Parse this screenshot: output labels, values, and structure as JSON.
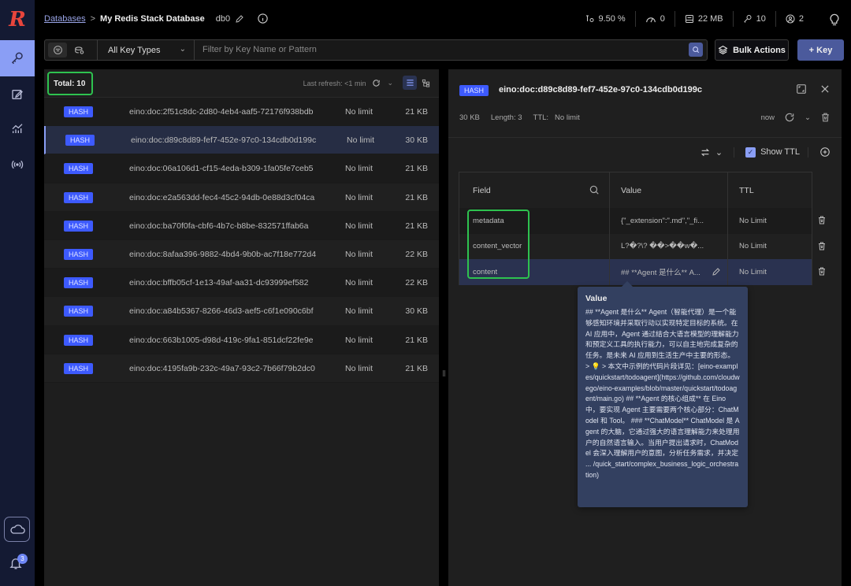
{
  "app": {
    "logo": "R"
  },
  "sidebar": {
    "items": [
      {
        "name": "browser",
        "icon": "key-icon",
        "active": true
      },
      {
        "name": "workbench",
        "icon": "edit-icon",
        "active": false
      },
      {
        "name": "analytics",
        "icon": "chart-icon",
        "active": false
      },
      {
        "name": "pubsub",
        "icon": "broadcast-icon",
        "active": false
      }
    ],
    "cloud_icon": "cloud-icon",
    "notifications_count": "3"
  },
  "header": {
    "breadcrumb_link": "Databases",
    "breadcrumb_sep": ">",
    "database_name": "My Redis Stack Database",
    "db_index": "db0",
    "stats": {
      "cpu": "9.50 %",
      "ops": "0",
      "memory": "22 MB",
      "keys": "10",
      "clients": "2"
    }
  },
  "toolbar": {
    "key_type_selected": "All Key Types",
    "filter_placeholder": "Filter by Key Name or Pattern",
    "bulk_actions_label": "Bulk Actions",
    "add_key_label": "+ Key"
  },
  "key_list": {
    "total_label": "Total: 10",
    "last_refresh": "Last refresh: <1 min",
    "rows": [
      {
        "type": "HASH",
        "name": "eino:doc:2f51c8dc-2d80-4eb4-aaf5-72176f938bdb",
        "ttl": "No limit",
        "size": "21 KB"
      },
      {
        "type": "HASH",
        "name": "eino:doc:d89c8d89-fef7-452e-97c0-134cdb0d199c",
        "ttl": "No limit",
        "size": "30 KB",
        "selected": true
      },
      {
        "type": "HASH",
        "name": "eino:doc:06a106d1-cf15-4eda-b309-1fa05fe7ceb5",
        "ttl": "No limit",
        "size": "21 KB"
      },
      {
        "type": "HASH",
        "name": "eino:doc:e2a563dd-fec4-45c2-94db-0e88d3cf04ca",
        "ttl": "No limit",
        "size": "21 KB"
      },
      {
        "type": "HASH",
        "name": "eino:doc:ba70f0fa-cbf6-4b7c-b8be-832571ffab6a",
        "ttl": "No limit",
        "size": "21 KB"
      },
      {
        "type": "HASH",
        "name": "eino:doc:8afaa396-9882-4bd4-9b0b-ac7f18e772d4",
        "ttl": "No limit",
        "size": "22 KB"
      },
      {
        "type": "HASH",
        "name": "eino:doc:bffb05cf-1e13-49af-aa31-dc93999ef582",
        "ttl": "No limit",
        "size": "22 KB"
      },
      {
        "type": "HASH",
        "name": "eino:doc:a84b5367-8266-46d3-aef5-c6f1e090c6bf",
        "ttl": "No limit",
        "size": "30 KB"
      },
      {
        "type": "HASH",
        "name": "eino:doc:663b1005-d98d-419c-9fa1-851dcf22fe9e",
        "ttl": "No limit",
        "size": "21 KB"
      },
      {
        "type": "HASH",
        "name": "eino:doc:4195fa9b-232c-49a7-93c2-7b66f79b2dc0",
        "ttl": "No limit",
        "size": "21 KB"
      }
    ]
  },
  "details": {
    "type": "HASH",
    "key": "eino:doc:d89c8d89-fef7-452e-97c0-134cdb0d199c",
    "size": "30 KB",
    "length": "Length: 3",
    "ttl_label": "TTL:",
    "ttl_value": "No limit",
    "refreshed": "now",
    "show_ttl_label": "Show TTL",
    "show_ttl_checked": true,
    "columns": {
      "field": "Field",
      "value": "Value",
      "ttl": "TTL"
    },
    "fields": [
      {
        "field": "metadata",
        "value": "{\"_extension\":\".md\",\"_fi...",
        "ttl": "No Limit"
      },
      {
        "field": "content_vector",
        "value": "L?�?\\? ��>��w�...",
        "ttl": "No Limit"
      },
      {
        "field": "content",
        "value": "## **Agent 是什么** A...",
        "ttl": "No Limit",
        "selected": true
      }
    ],
    "tooltip": {
      "title": "Value",
      "text": "## **Agent 是什么** Agent（智能代理）是一个能够感知环境并采取行动以实现特定目标的系统。在 AI 应用中，Agent 通过结合大语言模型的理解能力和预定义工具的执行能力，可以自主地完成复杂的任务。是未来 AI 应用到生活生产中主要的形态。 > 💡 > 本文中示例的代码片段详见：[eino-examples/quickstart/todoagent](https://github.com/cloudwego/eino-examples/blob/master/quickstart/todoagent/main.go) ## **Agent 的核心组成** 在 Eino 中，要实现 Agent 主要需要两个核心部分：ChatModel 和 Tool。 ### **ChatModel** ChatModel 是 Agent 的大脑，它通过强大的语言理解能力来处理用户的自然语言输入。当用户提出请求时，ChatModel 会深入理解用户的意图，分析任务需求，并决定 ... /quick_start/complex_business_logic_orchestration)"
    }
  },
  "colors": {
    "accent": "#8a9ef5",
    "hash_badge": "#3d5afe",
    "primary_button": "#4b5a9c",
    "highlight": "#2ec24f"
  }
}
